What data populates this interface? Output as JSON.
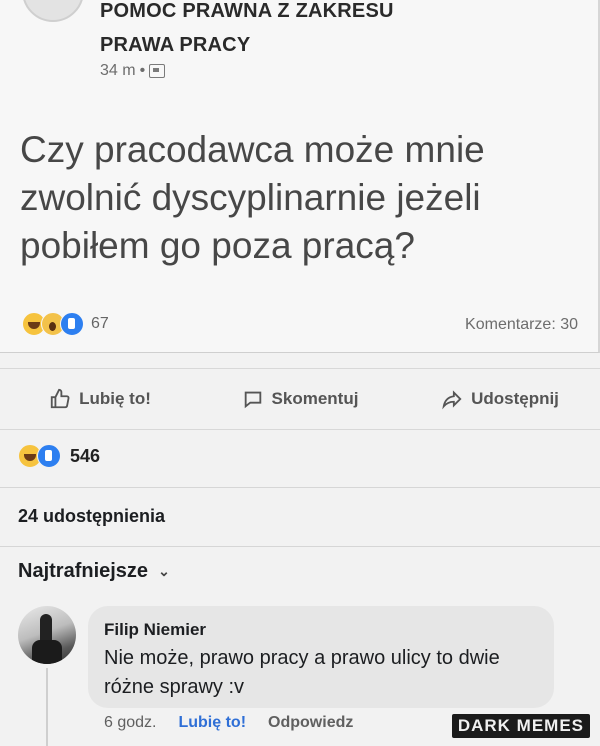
{
  "shared_post": {
    "page_name_line1": "POMOC PRAWNA Z ZAKRESU",
    "page_name_line2": "PRAWA PRACY",
    "time": "34 m",
    "separator": "•",
    "text": "Czy pracodawca może mnie zwolnić dyscyplinarnie jeżeli pobiłem go poza pracą?",
    "reaction_icons": [
      "haha-emoji-icon",
      "wow-emoji-icon",
      "like-emoji-icon"
    ],
    "reaction_count": "67",
    "comments_label": "Komentarze: 30"
  },
  "action_bar": {
    "like_label": "Lubię to!",
    "comment_label": "Skomentuj",
    "share_label": "Udostępnij"
  },
  "summary": {
    "reaction_icons": [
      "haha-emoji-icon",
      "like-emoji-icon"
    ],
    "reaction_count": "546",
    "shares_label": "24 udostępnienia",
    "sort_label": "Najtrafniejsze"
  },
  "comment": {
    "author": "Filip Niemier",
    "text": "Nie może, prawo pracy a prawo ulicy to dwie różne sprawy :v",
    "time": "6 godz.",
    "like_label": "Lubię to!",
    "reply_label": "Odpowiedz"
  },
  "watermark": {
    "text": "DARK MEMES"
  },
  "colors": {
    "like_blue": "#2f6fd6",
    "reaction_blue": "#2d7ff0",
    "haha_yellow": "#f6c33e"
  }
}
